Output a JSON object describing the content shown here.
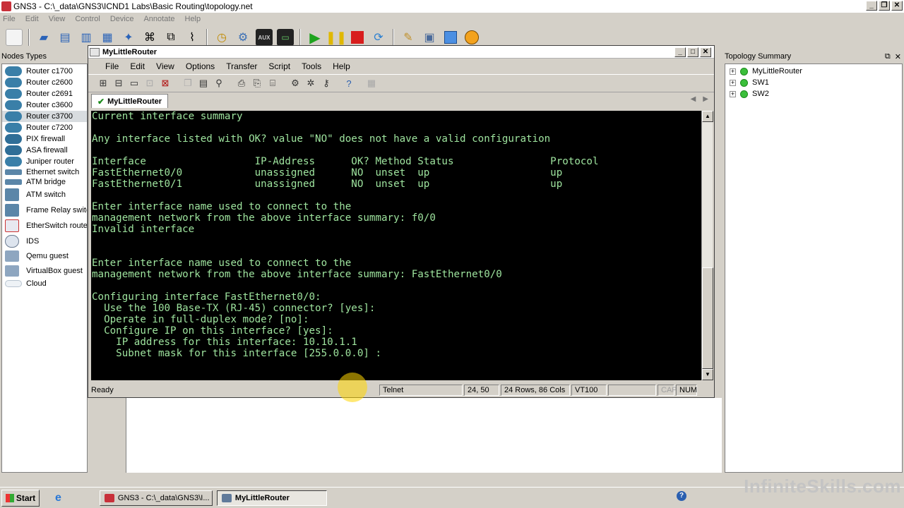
{
  "gns3": {
    "title": "GNS3 - C:\\_data\\GNS3\\ICND1 Labs\\Basic Routing\\topology.net",
    "menu": [
      "File",
      "Edit",
      "View",
      "Control",
      "Device",
      "Annotate",
      "Help"
    ]
  },
  "nodes_panel": {
    "title": "Nodes Types",
    "items": [
      {
        "label": "Router c1700",
        "icon": "router-icon"
      },
      {
        "label": "Router c2600",
        "icon": "router-icon"
      },
      {
        "label": "Router c2691",
        "icon": "router-icon"
      },
      {
        "label": "Router c3600",
        "icon": "router-icon"
      },
      {
        "label": "Router c3700",
        "icon": "router-icon",
        "selected": true
      },
      {
        "label": "Router c7200",
        "icon": "router-icon"
      },
      {
        "label": "PIX firewall",
        "icon": "firewall-icon"
      },
      {
        "label": "ASA firewall",
        "icon": "firewall-icon"
      },
      {
        "label": "Juniper router",
        "icon": "router-icon"
      },
      {
        "label": "Ethernet switch",
        "icon": "switch-icon"
      },
      {
        "label": "ATM bridge",
        "icon": "bridge-icon"
      },
      {
        "label": "ATM switch",
        "icon": "atm-switch-icon"
      },
      {
        "label": "Frame Relay switc",
        "icon": "frame-relay-icon"
      },
      {
        "label": "EtherSwitch route",
        "icon": "etherswitch-icon"
      },
      {
        "label": "IDS",
        "icon": "ids-icon"
      },
      {
        "label": "Qemu guest",
        "icon": "pc-icon"
      },
      {
        "label": "VirtualBox guest",
        "icon": "pc-icon"
      },
      {
        "label": "Cloud",
        "icon": "cloud-icon"
      }
    ]
  },
  "topology": {
    "title": "Topology Summary",
    "items": [
      "MyLittleRouter",
      "SW1",
      "SW2"
    ]
  },
  "crt": {
    "title": "MyLittleRouter",
    "menu": [
      "File",
      "Edit",
      "View",
      "Options",
      "Transfer",
      "Script",
      "Tools",
      "Help"
    ],
    "tab": "MyLittleRouter",
    "terminal_lines": [
      "Current interface summary",
      "",
      "Any interface listed with OK? value \"NO\" does not have a valid configuration",
      "",
      "Interface                  IP-Address      OK? Method Status                Protocol",
      "FastEthernet0/0            unassigned      NO  unset  up                    up",
      "FastEthernet0/1            unassigned      NO  unset  up                    up",
      "",
      "Enter interface name used to connect to the",
      "management network from the above interface summary: f0/0",
      "Invalid interface",
      "",
      "",
      "Enter interface name used to connect to the",
      "management network from the above interface summary: FastEthernet0/0",
      "",
      "Configuring interface FastEthernet0/0:",
      "  Use the 100 Base-TX (RJ-45) connector? [yes]:",
      "  Operate in full-duplex mode? [no]:",
      "  Configure IP on this interface? [yes]:",
      "    IP address for this interface: 10.10.1.1",
      "    Subnet mask for this interface [255.0.0.0] :"
    ],
    "status": {
      "state": "Ready",
      "protocol": "Telnet",
      "cursor": "24,  50",
      "size": "24 Rows,  86 Cols",
      "emulation": "VT100",
      "cap": "CAP",
      "num": "NUM"
    }
  },
  "taskbar": {
    "start": "Start",
    "tasks": [
      "GNS3 - C:\\_data\\GNS3\\I...",
      "MyLittleRouter"
    ]
  },
  "watermark": "InfiniteSkills.com"
}
